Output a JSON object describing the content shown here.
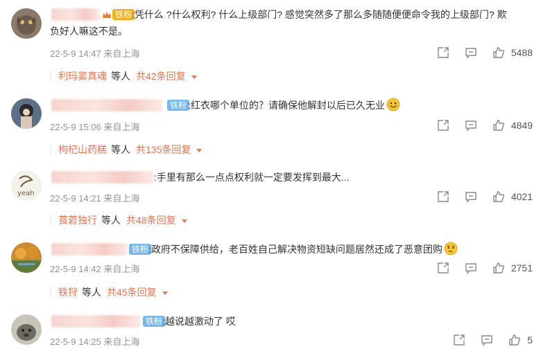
{
  "comments": [
    {
      "badge": "铁粉",
      "text1": ":凭什么 ?什么权利? 什么上级部门? 感觉突然多了那么多随随便便命令我的上级部门? 欺",
      "text2": "负好人嘛这不是。",
      "time": "22-5-9 14:47 来自上海",
      "likes": "5488",
      "reply_name": "利玛窦真魂",
      "reply_mid": "等人",
      "reply_total": "共42条回复"
    },
    {
      "badge": "铁粉",
      "text1": ":红衣哪个单位的？请确保他解封以后已久无业",
      "time": "22-5-9 15:06 来自上海",
      "likes": "4849",
      "reply_name": "枸杞山药糕",
      "reply_mid": "等人",
      "reply_total": "共135条回复"
    },
    {
      "text1": "‌:手里有那么一点点权利就一定要发挥到最大...",
      "time": "22-5-9 14:21 来自上海",
      "likes": "4021",
      "reply_name": "莨菪独行",
      "reply_mid": "等人",
      "reply_total": "共48条回复"
    },
    {
      "badge": "铁粉",
      "text1": ":政府不保障供给，老百姓自己解决物资短缺问题居然还成了恶意团购",
      "time": "22-5-9 14:42 来自上海",
      "likes": "2751",
      "reply_name": "铁狩",
      "reply_mid": "等人",
      "reply_total": "共45条回复"
    },
    {
      "badge": "铁粉",
      "text1": ":越说越激动了 哎",
      "time": "22-5-9 14:25 来自上海",
      "likes": "5"
    }
  ],
  "icons": {
    "share": "share-icon",
    "comment": "comment-icon",
    "like": "thumbs-up-icon"
  },
  "colors": {
    "accent": "#eb7350",
    "badge": "#74b7f1",
    "gold": "#f3b11e",
    "meta": "#939393"
  }
}
